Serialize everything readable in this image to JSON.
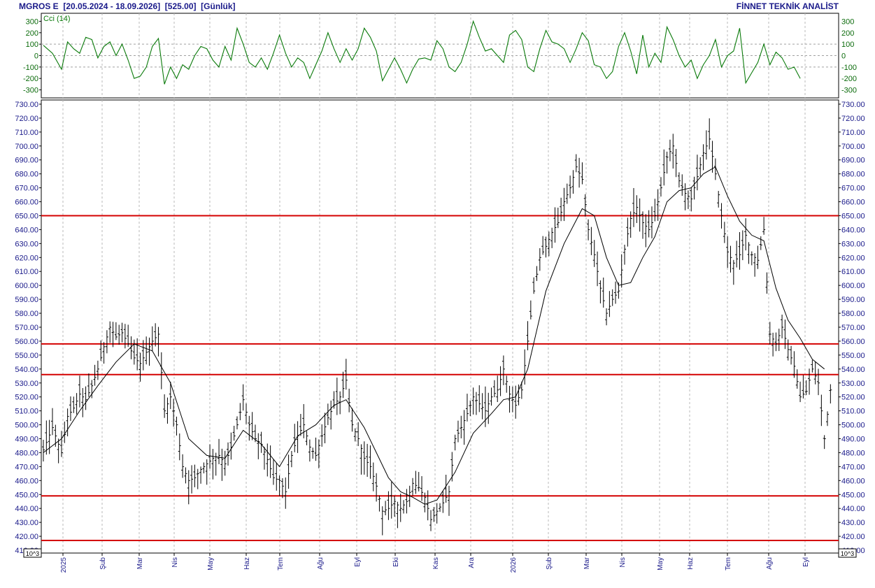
{
  "header": {
    "symbol": "MGROS E",
    "range": "[20.05.2024 - 18.09.2026]",
    "last": "[525.00]",
    "period": "[Günlük]",
    "brand": "FİNNET TEKNİK ANALİST"
  },
  "colors": {
    "frame": "#000000",
    "cci_line": "#0a7a0a",
    "price_bar": "#000000",
    "moving_average": "#000000",
    "hline": "#d40000",
    "axis_text": "#1a1a8a"
  },
  "chart_data": [
    {
      "type": "line",
      "indicator": "CCI",
      "legend": "Cci (14)",
      "ylim": [
        -370,
        370
      ],
      "yticks": [
        300,
        200,
        100,
        0,
        -100,
        -200,
        -300
      ],
      "reference_lines": [
        100,
        0,
        -100
      ],
      "series": [
        {
          "points": [
            [
              0,
              90
            ],
            [
              3,
              20
            ],
            [
              6,
              -120
            ],
            [
              8,
              120
            ],
            [
              10,
              60
            ],
            [
              12,
              20
            ],
            [
              14,
              160
            ],
            [
              16,
              140
            ],
            [
              18,
              -20
            ],
            [
              20,
              80
            ],
            [
              22,
              120
            ],
            [
              24,
              0
            ],
            [
              26,
              100
            ],
            [
              28,
              -40
            ],
            [
              30,
              -200
            ],
            [
              32,
              -180
            ],
            [
              34,
              -100
            ],
            [
              36,
              80
            ],
            [
              38,
              150
            ],
            [
              40,
              -250
            ],
            [
              42,
              -100
            ],
            [
              44,
              -200
            ],
            [
              46,
              -80
            ],
            [
              48,
              -120
            ],
            [
              50,
              0
            ],
            [
              52,
              80
            ],
            [
              54,
              60
            ],
            [
              56,
              -40
            ],
            [
              58,
              -100
            ],
            [
              60,
              80
            ],
            [
              62,
              -40
            ],
            [
              64,
              240
            ],
            [
              66,
              100
            ],
            [
              68,
              -60
            ],
            [
              70,
              -100
            ],
            [
              72,
              -20
            ],
            [
              74,
              -120
            ],
            [
              76,
              20
            ],
            [
              78,
              180
            ],
            [
              80,
              20
            ],
            [
              82,
              -100
            ],
            [
              84,
              -20
            ],
            [
              86,
              -60
            ],
            [
              88,
              -200
            ],
            [
              90,
              -80
            ],
            [
              92,
              40
            ],
            [
              94,
              200
            ],
            [
              96,
              60
            ],
            [
              98,
              -60
            ],
            [
              100,
              60
            ],
            [
              102,
              -40
            ],
            [
              104,
              60
            ],
            [
              106,
              240
            ],
            [
              108,
              160
            ],
            [
              110,
              40
            ],
            [
              112,
              -220
            ],
            [
              114,
              -120
            ],
            [
              116,
              -20
            ],
            [
              118,
              -120
            ],
            [
              120,
              -240
            ],
            [
              122,
              -120
            ],
            [
              124,
              -30
            ],
            [
              126,
              -20
            ],
            [
              128,
              -40
            ],
            [
              130,
              130
            ],
            [
              132,
              60
            ],
            [
              134,
              -100
            ],
            [
              136,
              -140
            ],
            [
              138,
              -60
            ],
            [
              140,
              100
            ],
            [
              142,
              300
            ],
            [
              144,
              160
            ],
            [
              146,
              40
            ],
            [
              148,
              60
            ],
            [
              150,
              0
            ],
            [
              152,
              -60
            ],
            [
              154,
              180
            ],
            [
              156,
              220
            ],
            [
              158,
              140
            ],
            [
              160,
              -100
            ],
            [
              162,
              -140
            ],
            [
              164,
              60
            ],
            [
              166,
              220
            ],
            [
              168,
              120
            ],
            [
              170,
              100
            ],
            [
              172,
              60
            ],
            [
              174,
              -60
            ],
            [
              176,
              60
            ],
            [
              178,
              200
            ],
            [
              180,
              130
            ],
            [
              182,
              -80
            ],
            [
              184,
              -100
            ],
            [
              186,
              -200
            ],
            [
              188,
              -140
            ],
            [
              190,
              80
            ],
            [
              192,
              200
            ],
            [
              194,
              40
            ],
            [
              196,
              -160
            ],
            [
              198,
              180
            ],
            [
              200,
              -100
            ],
            [
              202,
              20
            ],
            [
              204,
              -60
            ],
            [
              206,
              250
            ],
            [
              208,
              140
            ],
            [
              210,
              0
            ],
            [
              212,
              -100
            ],
            [
              214,
              -40
            ],
            [
              216,
              -200
            ],
            [
              218,
              -80
            ],
            [
              220,
              0
            ],
            [
              222,
              140
            ],
            [
              224,
              -100
            ],
            [
              226,
              0
            ],
            [
              228,
              40
            ],
            [
              230,
              240
            ],
            [
              232,
              -240
            ],
            [
              234,
              -150
            ],
            [
              236,
              -60
            ],
            [
              238,
              100
            ],
            [
              240,
              -80
            ],
            [
              242,
              30
            ],
            [
              244,
              -20
            ],
            [
              246,
              -120
            ],
            [
              248,
              -100
            ],
            [
              250,
              -200
            ]
          ]
        }
      ]
    },
    {
      "type": "bar",
      "style": "ohlc",
      "ylim": [
        408,
        733
      ],
      "yticks": [
        730,
        720,
        710,
        700,
        690,
        680,
        670,
        660,
        650,
        640,
        630,
        620,
        610,
        600,
        590,
        580,
        570,
        560,
        550,
        540,
        530,
        520,
        510,
        500,
        490,
        480,
        470,
        460,
        450,
        440,
        430,
        420,
        410
      ],
      "ytick_format": "2dp",
      "scale_label": "10^3",
      "x_tick_labels": [
        "2025",
        "Şub",
        "Mar",
        "Nis",
        "May",
        "Haz",
        "Tem",
        "Ağu",
        "Eyl",
        "Eki",
        "Kas",
        "Ara",
        "2026",
        "Şub",
        "Mar",
        "Nis",
        "May",
        "Haz",
        "Tem",
        "Ağu",
        "Eyl"
      ],
      "horizontal_lines": [
        650,
        558,
        536,
        449,
        417
      ],
      "close_path": [
        [
          0,
          482
        ],
        [
          3,
          498
        ],
        [
          6,
          480
        ],
        [
          8,
          506
        ],
        [
          10,
          512
        ],
        [
          12,
          522
        ],
        [
          14,
          518
        ],
        [
          16,
          528
        ],
        [
          18,
          540
        ],
        [
          20,
          556
        ],
        [
          22,
          570
        ],
        [
          24,
          563
        ],
        [
          26,
          566
        ],
        [
          28,
          558
        ],
        [
          30,
          548
        ],
        [
          32,
          544
        ],
        [
          34,
          552
        ],
        [
          36,
          560
        ],
        [
          38,
          565
        ],
        [
          40,
          510
        ],
        [
          42,
          520
        ],
        [
          44,
          500
        ],
        [
          46,
          470
        ],
        [
          48,
          460
        ],
        [
          50,
          462
        ],
        [
          52,
          468
        ],
        [
          54,
          472
        ],
        [
          56,
          476
        ],
        [
          58,
          478
        ],
        [
          60,
          472
        ],
        [
          62,
          484
        ],
        [
          64,
          500
        ],
        [
          66,
          518
        ],
        [
          68,
          500
        ],
        [
          70,
          490
        ],
        [
          72,
          486
        ],
        [
          74,
          475
        ],
        [
          76,
          462
        ],
        [
          78,
          460
        ],
        [
          80,
          452
        ],
        [
          82,
          478
        ],
        [
          84,
          492
        ],
        [
          86,
          500
        ],
        [
          88,
          484
        ],
        [
          90,
          478
        ],
        [
          92,
          492
        ],
        [
          94,
          505
        ],
        [
          96,
          514
        ],
        [
          98,
          520
        ],
        [
          100,
          532
        ],
        [
          102,
          500
        ],
        [
          104,
          490
        ],
        [
          106,
          476
        ],
        [
          108,
          470
        ],
        [
          110,
          456
        ],
        [
          112,
          438
        ],
        [
          114,
          440
        ],
        [
          116,
          445
        ],
        [
          118,
          440
        ],
        [
          120,
          445
        ],
        [
          122,
          458
        ],
        [
          124,
          455
        ],
        [
          126,
          448
        ],
        [
          128,
          432
        ],
        [
          130,
          438
        ],
        [
          132,
          444
        ],
        [
          134,
          452
        ],
        [
          136,
          490
        ],
        [
          138,
          498
        ],
        [
          140,
          508
        ],
        [
          142,
          520
        ],
        [
          144,
          515
        ],
        [
          146,
          510
        ],
        [
          148,
          520
        ],
        [
          150,
          525
        ],
        [
          152,
          540
        ],
        [
          154,
          522
        ],
        [
          156,
          514
        ],
        [
          158,
          525
        ],
        [
          160,
          560
        ],
        [
          162,
          596
        ],
        [
          164,
          620
        ],
        [
          166,
          628
        ],
        [
          168,
          638
        ],
        [
          170,
          645
        ],
        [
          172,
          660
        ],
        [
          174,
          670
        ],
        [
          176,
          685
        ],
        [
          178,
          676
        ],
        [
          180,
          640
        ],
        [
          182,
          622
        ],
        [
          184,
          598
        ],
        [
          186,
          580
        ],
        [
          188,
          590
        ],
        [
          190,
          596
        ],
        [
          192,
          626
        ],
        [
          194,
          648
        ],
        [
          196,
          656
        ],
        [
          198,
          645
        ],
        [
          200,
          640
        ],
        [
          202,
          650
        ],
        [
          204,
          670
        ],
        [
          206,
          692
        ],
        [
          208,
          700
        ],
        [
          210,
          675
        ],
        [
          212,
          666
        ],
        [
          214,
          662
        ],
        [
          216,
          678
        ],
        [
          218,
          695
        ],
        [
          220,
          705
        ],
        [
          222,
          680
        ],
        [
          224,
          650
        ],
        [
          226,
          624
        ],
        [
          228,
          616
        ],
        [
          230,
          622
        ],
        [
          232,
          636
        ],
        [
          234,
          622
        ],
        [
          236,
          618
        ],
        [
          238,
          640
        ],
        [
          240,
          565
        ],
        [
          242,
          558
        ],
        [
          244,
          570
        ],
        [
          246,
          554
        ],
        [
          248,
          542
        ],
        [
          250,
          520
        ],
        [
          252,
          524
        ],
        [
          254,
          540
        ],
        [
          256,
          530
        ],
        [
          258,
          490
        ],
        [
          260,
          525
        ]
      ],
      "moving_average_path": [
        [
          0,
          480
        ],
        [
          6,
          490
        ],
        [
          12,
          510
        ],
        [
          18,
          528
        ],
        [
          24,
          545
        ],
        [
          30,
          558
        ],
        [
          36,
          553
        ],
        [
          42,
          530
        ],
        [
          48,
          490
        ],
        [
          54,
          478
        ],
        [
          60,
          476
        ],
        [
          66,
          496
        ],
        [
          72,
          486
        ],
        [
          78,
          470
        ],
        [
          84,
          492
        ],
        [
          90,
          500
        ],
        [
          96,
          514
        ],
        [
          100,
          518
        ],
        [
          106,
          498
        ],
        [
          110,
          480
        ],
        [
          114,
          462
        ],
        [
          118,
          452
        ],
        [
          122,
          448
        ],
        [
          126,
          443
        ],
        [
          130,
          446
        ],
        [
          136,
          466
        ],
        [
          142,
          494
        ],
        [
          148,
          508
        ],
        [
          152,
          518
        ],
        [
          156,
          520
        ],
        [
          160,
          540
        ],
        [
          166,
          596
        ],
        [
          172,
          630
        ],
        [
          178,
          655
        ],
        [
          182,
          650
        ],
        [
          186,
          620
        ],
        [
          190,
          600
        ],
        [
          194,
          602
        ],
        [
          198,
          620
        ],
        [
          202,
          635
        ],
        [
          206,
          660
        ],
        [
          210,
          668
        ],
        [
          214,
          670
        ],
        [
          218,
          680
        ],
        [
          222,
          685
        ],
        [
          226,
          664
        ],
        [
          230,
          646
        ],
        [
          234,
          636
        ],
        [
          238,
          632
        ],
        [
          242,
          598
        ],
        [
          246,
          575
        ],
        [
          250,
          562
        ],
        [
          254,
          547
        ],
        [
          258,
          540
        ]
      ]
    }
  ]
}
